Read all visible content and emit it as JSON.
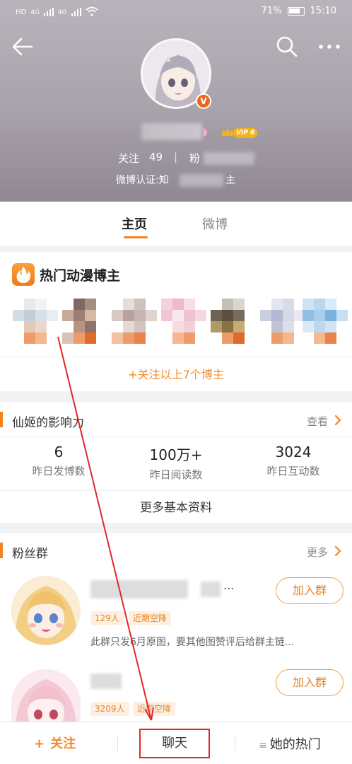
{
  "status_bar": {
    "network_left": "4G",
    "network_right": "4G",
    "battery": "71%",
    "time": "15:10"
  },
  "profile": {
    "verified_badge": "V",
    "vip_label": "VIP 6",
    "following_label": "关注",
    "following_count": "49",
    "fans_label": "粉",
    "verify_prefix": "微博认证:知",
    "verify_suffix": "主"
  },
  "tabs": [
    {
      "label": "主页"
    },
    {
      "label": "微博"
    }
  ],
  "hot_card": {
    "title": "热门动漫博主",
    "follow_all": "+关注以上7个博主"
  },
  "influence": {
    "title": "仙姬的影响力",
    "link": "查看",
    "stats": [
      {
        "value": "6",
        "label": "昨日发博数"
      },
      {
        "value": "100万+",
        "label": "昨日阅读数"
      },
      {
        "value": "3024",
        "label": "昨日互动数"
      }
    ],
    "more": "更多基本资料"
  },
  "fans": {
    "title": "粉丝群",
    "link": "更多",
    "groups": [
      {
        "name_tail": "...",
        "members": "129人",
        "tag": "近期空降",
        "desc": "此群只发6月原图，要其他图赞评后给群主链...",
        "join": "加入群"
      },
      {
        "members": "3209人",
        "tag": "近期空降",
        "join": "加入群"
      }
    ]
  },
  "bottom_bar": {
    "follow": "关注",
    "chat": "聊天",
    "hot": "她的热门"
  },
  "colors": {
    "accent": "#f58220",
    "annotation": "#e0282b"
  }
}
